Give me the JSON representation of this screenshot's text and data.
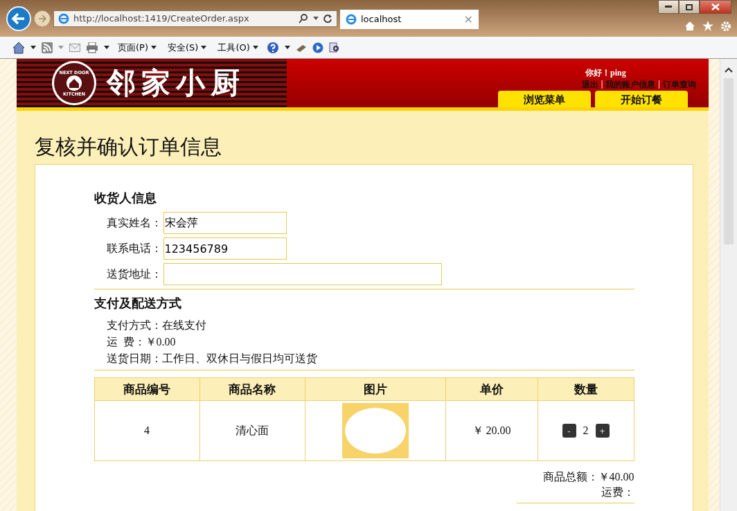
{
  "browser": {
    "address": "http://localhost:1419/CreateOrder.aspx",
    "tab": {
      "title": "localhost",
      "close": "×"
    },
    "toolbar": [
      {
        "label": "页面(P)"
      },
      {
        "label": "安全(S)"
      },
      {
        "label": "工具(O)"
      }
    ]
  },
  "header": {
    "logo_badge": [
      "NEXT DOOR",
      "KITCHEN"
    ],
    "logo_title": "邻家小厨",
    "greeting": "你好！",
    "username": "ping",
    "separator": "|",
    "links": [
      "退出",
      "我的账户信息",
      "订单查询"
    ],
    "nav": [
      {
        "label": "浏览菜单"
      },
      {
        "label": "开始订餐"
      }
    ]
  },
  "page_title": "复核并确认订单信息",
  "recipient": {
    "heading": "收货人信息",
    "fields": [
      {
        "label": "真实姓名：",
        "value": "宋会萍",
        "kind": "short"
      },
      {
        "label": "联系电话：",
        "value": "123456789",
        "kind": "short"
      },
      {
        "label": "送货地址：",
        "kind": "long"
      }
    ]
  },
  "payment": {
    "heading": "支付及配送方式",
    "lines": [
      "支付方式：在线支付",
      "运  费：￥0.00",
      "送货日期：工作日、双休日与假日均可送货"
    ]
  },
  "order_table": {
    "columns": [
      "商品编号",
      "商品名称",
      "图片",
      "单价",
      "数量"
    ],
    "rows": [
      {
        "id": "4",
        "name": "清心面",
        "price": "￥ 20.00",
        "quantity": "2",
        "minus": "-",
        "plus": "+"
      }
    ]
  },
  "summary": [
    {
      "label": "商品总额：",
      "value": "￥40.00"
    },
    {
      "label": "运费："
    }
  ]
}
